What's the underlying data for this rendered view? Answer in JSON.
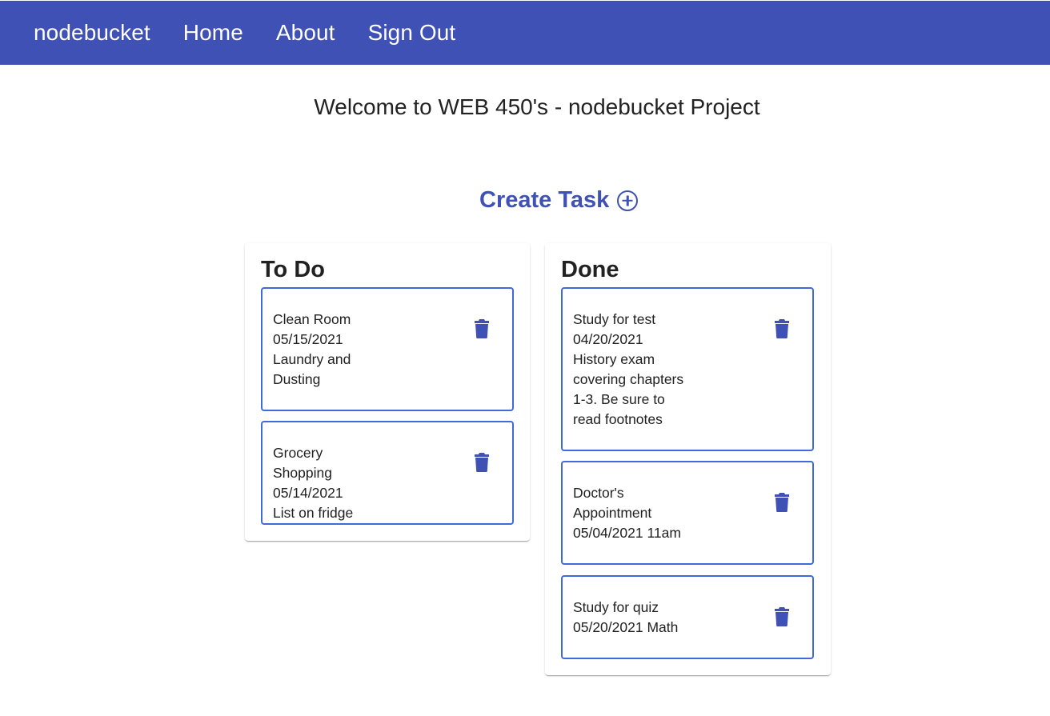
{
  "nav": {
    "brand": "nodebucket",
    "home": "Home",
    "about": "About",
    "sign_out": "Sign Out"
  },
  "welcome": "Welcome to WEB 450's - nodebucket Project",
  "create_task": {
    "label": "Create Task",
    "icon": "add-circle-outline-icon"
  },
  "colors": {
    "primary": "#3f51b5",
    "card_border": "#3f6ad8"
  },
  "todo": {
    "title": "To Do",
    "tasks": [
      {
        "lines": [
          "Clean Room",
          "05/15/2021",
          "Laundry and",
          "Dusting"
        ]
      },
      {
        "lines": [
          "Grocery Shopping",
          "05/14/2021",
          "List on fridge"
        ]
      }
    ]
  },
  "done": {
    "title": "Done",
    "tasks": [
      {
        "lines": [
          "Study for test",
          "04/20/2021",
          "History exam",
          "covering chapters",
          "1-3. Be sure to",
          "read footnotes"
        ]
      },
      {
        "lines": [
          "Doctor's",
          "Appointment",
          "05/04/2021 11am"
        ]
      },
      {
        "lines": [
          "Study for quiz",
          "05/20/2021 Math"
        ]
      }
    ]
  }
}
